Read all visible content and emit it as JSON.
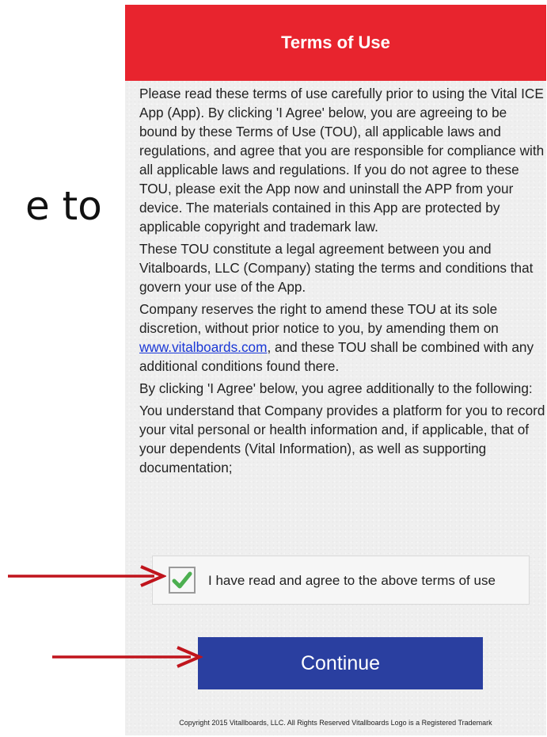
{
  "slide": {
    "partial_text": "e to"
  },
  "header": {
    "title": "Terms of Use",
    "background": "#e8242e"
  },
  "terms": {
    "p1": "Please read these terms of use carefully prior to using the Vital ICE App (App). By clicking 'I Agree' below, you are agreeing to be bound by these Terms of Use (TOU), all applicable laws and regulations, and agree that you are responsible for compliance with all applicable laws and regulations. If you do not agree to these TOU, please exit the App now and uninstall the APP from your device. The materials contained in this App are protected by applicable copyright and trademark law.",
    "p2": "These TOU constitute a legal agreement between you and Vitalboards, LLC (Company) stating the terms and conditions that govern your use of the App.",
    "p3_before": "Company reserves the right to amend these TOU at its sole discretion, without prior notice to you, by amending them on ",
    "p3_link": "www.vitalboards.com",
    "p3_after": ", and these TOU shall be combined with any additional conditions found there.",
    "p4": "By clicking 'I Agree' below, you agree additionally to the following:",
    "p5": "You understand that Company provides a platform for you to record your vital personal or health information and, if applicable, that of your dependents (Vital Information), as well as supporting documentation;"
  },
  "agreement": {
    "label": "I have read and agree to the above terms of use",
    "checked": true,
    "check_color": "#4caf50",
    "checkbox_icon": "checkmark-icon"
  },
  "continue_button": {
    "label": "Continue",
    "background": "#2a3fa0"
  },
  "footer": {
    "copyright": "Copyright 2015 Vitallboards, LLC. All Rights Reserved Vitallboards Logo is a Registered Trademark"
  },
  "annotations": {
    "arrow_color": "#c0141c",
    "arrow_icon": "right-arrow-icon"
  }
}
